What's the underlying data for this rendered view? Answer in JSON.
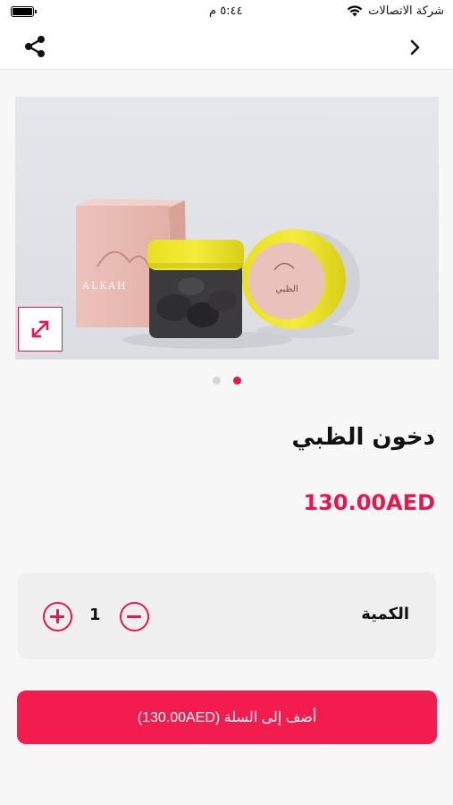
{
  "status_bar": {
    "carrier": "شركة الاتصالات",
    "time": "٥:٤٤ م"
  },
  "nav": {
    "share_icon": "share-icon",
    "back_icon": "chevron-right-icon"
  },
  "product": {
    "image_icon": "expand-icon",
    "gallery_count": 2,
    "gallery_active_index": 1,
    "name": "دخون الظبي",
    "price": "130.00AED",
    "box_logo_text": "ALKAH",
    "lid_label_text": "الظبي"
  },
  "quantity": {
    "label": "الكمية",
    "value": "1",
    "plus_icon": "plus-circle-icon",
    "minus_icon": "minus-circle-icon"
  },
  "cart": {
    "button_label": "أضف إلى السلة (130.00AED)"
  },
  "colors": {
    "accent": "#e7164f",
    "button": "#f21c4e",
    "background": "#f7f7f7",
    "card": "#efefef"
  }
}
